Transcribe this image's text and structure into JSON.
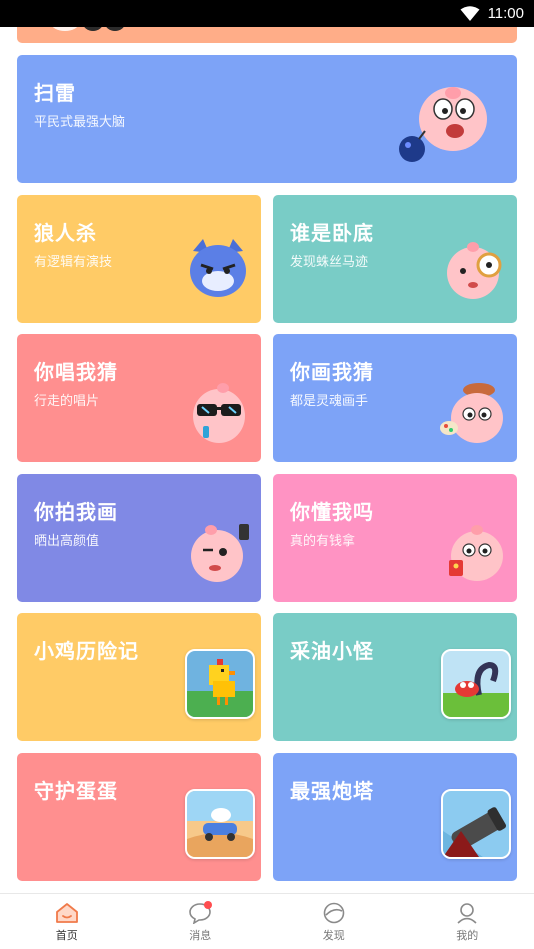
{
  "status_bar": {
    "time": "11:00"
  },
  "colors": {
    "orange_strip": "#FFAD88",
    "blue": "#7DA3F7",
    "yellow": "#FFCB66",
    "teal": "#79CCC6",
    "pink": "#FF8F8F",
    "indigo": "#8089E5",
    "magenta": "#FF93C3"
  },
  "cards": [
    {
      "id": "minesweeper",
      "title": "扫雷",
      "subtitle": "平民式最强大脑",
      "color": "blue",
      "art": "pig-with-bomb-mascot"
    },
    {
      "id": "werewolf",
      "title": "狼人杀",
      "subtitle": "有逻辑有演技",
      "color": "yellow",
      "art": "wolf-mascot"
    },
    {
      "id": "undercover",
      "title": "谁是卧底",
      "subtitle": "发现蛛丝马迹",
      "color": "teal",
      "art": "pig-magnifier-mascot"
    },
    {
      "id": "sing-guess",
      "title": "你唱我猜",
      "subtitle": "行走的唱片",
      "color": "pink",
      "art": "pig-sunglasses-mascot"
    },
    {
      "id": "draw-guess",
      "title": "你画我猜",
      "subtitle": "都是灵魂画手",
      "color": "blue",
      "art": "pig-painter-mascot"
    },
    {
      "id": "photo-draw",
      "title": "你拍我画",
      "subtitle": "晒出高颜值",
      "color": "indigo",
      "art": "pig-selfie-mascot"
    },
    {
      "id": "understand-me",
      "title": "你懂我吗",
      "subtitle": "真的有钱拿",
      "color": "magenta",
      "art": "pig-redpacket-mascot"
    },
    {
      "id": "chicken",
      "title": "小鸡历险记",
      "subtitle": "",
      "color": "yellow",
      "art": "chicken-game-icon"
    },
    {
      "id": "oil-monster",
      "title": "采油小怪",
      "subtitle": "",
      "color": "teal",
      "art": "oil-monster-game-icon"
    },
    {
      "id": "egg-guard",
      "title": "守护蛋蛋",
      "subtitle": "",
      "color": "pink",
      "art": "egg-car-game-icon"
    },
    {
      "id": "cannon-tower",
      "title": "最强炮塔",
      "subtitle": "",
      "color": "blue",
      "art": "cannon-game-icon"
    }
  ],
  "tabbar": [
    {
      "label": "首页",
      "icon": "home-icon",
      "active": true
    },
    {
      "label": "消息",
      "icon": "message-icon",
      "badge": true
    },
    {
      "label": "发现",
      "icon": "discover-icon"
    },
    {
      "label": "我的",
      "icon": "profile-icon"
    }
  ]
}
